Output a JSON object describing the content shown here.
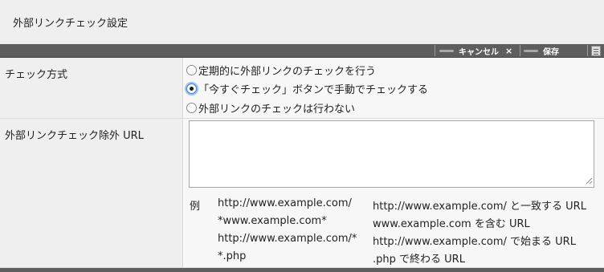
{
  "page": {
    "title": "外部リンクチェック設定"
  },
  "toolbar": {
    "cancel_label": "キャンセル",
    "cancel_close": "×",
    "save_label": "保存",
    "icons": {
      "dash": "dash-icon",
      "close": "close-icon",
      "doc": "document-icon"
    }
  },
  "check_method": {
    "label": "チェック方式",
    "options": [
      {
        "label": "定期的に外部リンクのチェックを行う",
        "selected": false
      },
      {
        "label": "「今すぐチェック」ボタンで手動でチェックする",
        "selected": true
      },
      {
        "label": "外部リンクのチェックは行わない",
        "selected": false
      }
    ]
  },
  "exclude_url": {
    "label": "外部リンクチェック除外 URL",
    "value": "",
    "example_heading": "例",
    "examples": [
      {
        "pattern": "http://www.example.com/",
        "description": "http://www.example.com/ と一致する URL"
      },
      {
        "pattern": "*www.example.com*",
        "description": "www.example.com を含む URL"
      },
      {
        "pattern": "http://www.example.com/*",
        "description": "http://www.example.com/ で始まる URL"
      },
      {
        "pattern": "*.php",
        "description": ".php で終わる URL"
      }
    ]
  },
  "colors": {
    "toolbar_bg": "#5e5e5e",
    "label_bg": "#efefef",
    "value_bg": "#f7f7f7",
    "radio_focus": "#3b7fe0"
  }
}
